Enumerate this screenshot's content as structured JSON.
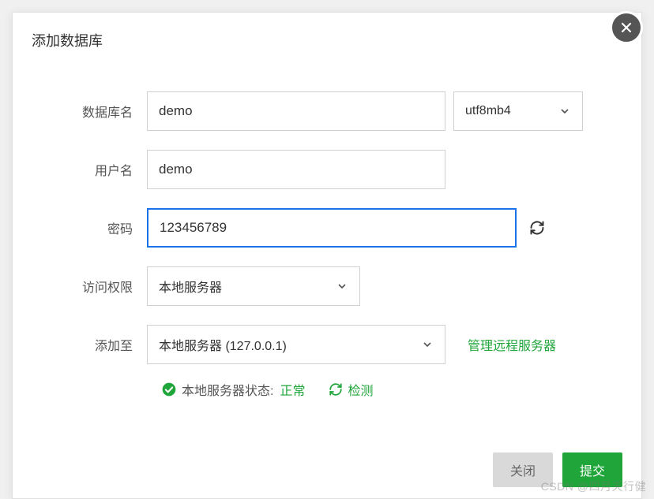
{
  "dialog": {
    "title": "添加数据库"
  },
  "form": {
    "dbname": {
      "label": "数据库名",
      "value": "demo"
    },
    "charset": {
      "selected": "utf8mb4"
    },
    "username": {
      "label": "用户名",
      "value": "demo"
    },
    "password": {
      "label": "密码",
      "value": "123456789"
    },
    "access": {
      "label": "访问权限",
      "selected": "本地服务器"
    },
    "addto": {
      "label": "添加至",
      "selected": "本地服务器 (127.0.0.1)"
    },
    "manage_remote_link": "管理远程服务器"
  },
  "status": {
    "label": "本地服务器状态:",
    "state": "正常",
    "detect": "检测"
  },
  "footer": {
    "close_label": "关闭",
    "submit_label": "提交"
  },
  "watermark": "CSDN @四月天行健"
}
